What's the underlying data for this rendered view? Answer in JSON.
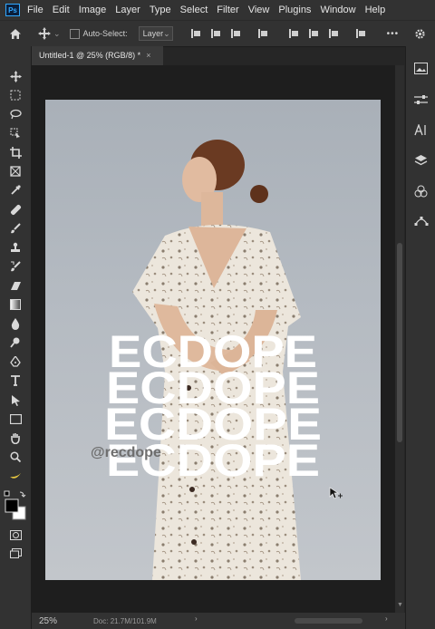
{
  "menu": {
    "logo": "Ps",
    "items": [
      "File",
      "Edit",
      "Image",
      "Layer",
      "Type",
      "Select",
      "Filter",
      "View",
      "Plugins",
      "Window",
      "Help"
    ]
  },
  "options": {
    "auto_select_label": "Auto-Select:",
    "layer_select_value": "Layer",
    "more_label": "•••"
  },
  "document": {
    "tab_title": "Untitled-1 @ 25% (RGB/8) *",
    "close_glyph": "×"
  },
  "artwork": {
    "word": "ECDOPE",
    "watermark": "@recdope"
  },
  "status": {
    "zoom": "25%",
    "doc_info": "Doc: 21.7M/101.9M"
  },
  "colors": {
    "background": "#1e1e1e",
    "panel": "#323232",
    "accent": "#31a8ff"
  }
}
